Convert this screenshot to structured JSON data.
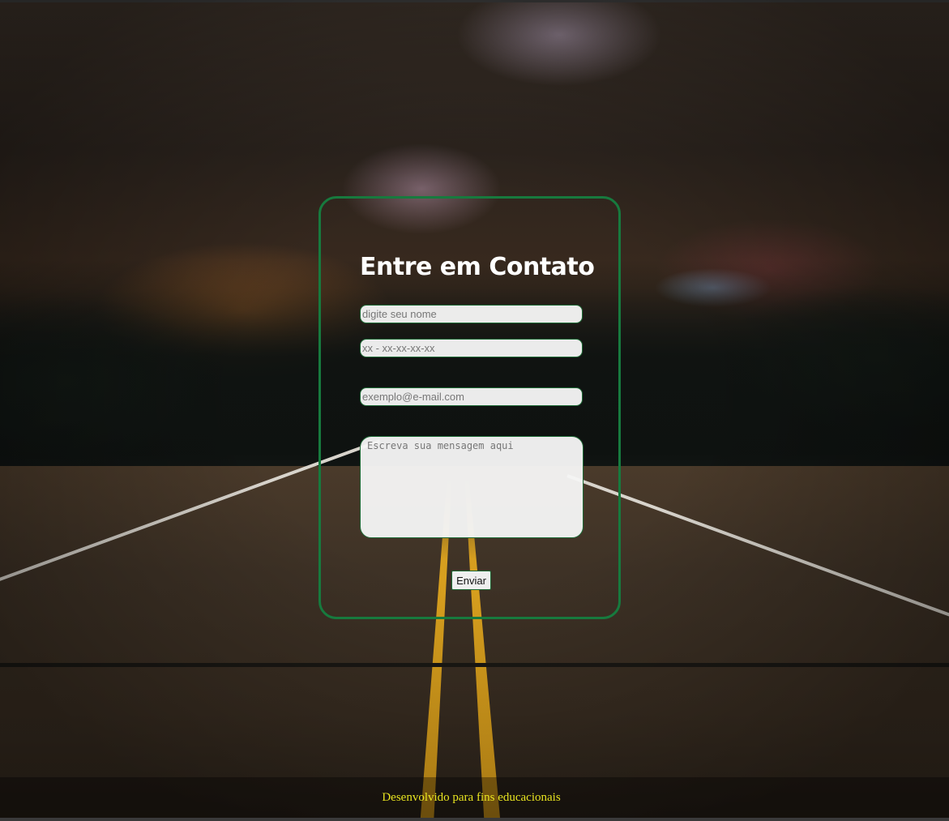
{
  "contact": {
    "title": "Entre em Contato",
    "name_placeholder": "digite seu nome",
    "phone_placeholder": "xx - xx-xx-xx-xx",
    "email_placeholder": "exemplo@e-mail.com",
    "message_placeholder": "Escreva sua mensagem aqui",
    "submit_label": "Enviar"
  },
  "footer": {
    "text": "Desenvolvido para fins educacionais"
  },
  "colors": {
    "card_border": "#177a3e",
    "title": "#ffffff",
    "footer_text": "#e8e420"
  }
}
